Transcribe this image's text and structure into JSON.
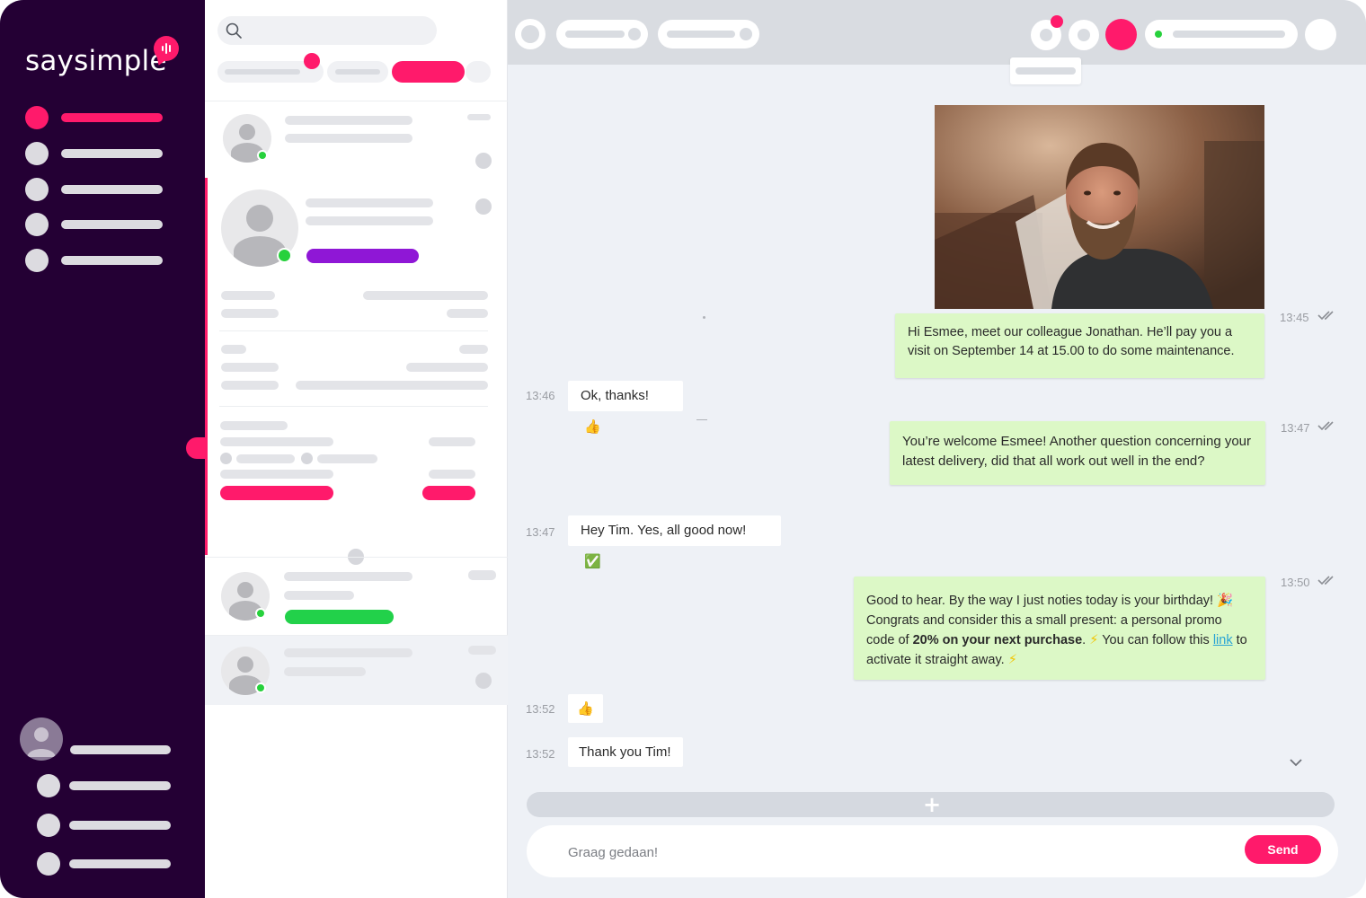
{
  "app": {
    "logo_text": "saysimple",
    "brand_color": "#ff1a6b",
    "sidebar_color": "#240034",
    "online_color": "#27d13c"
  },
  "icons": {
    "logo_badge": "audio-bars-icon",
    "search": "search-icon",
    "scroll_down": "chevron-down-icon",
    "attach": "plus-icon"
  },
  "messages": [
    {
      "direction": "out",
      "time": "13:45",
      "has_image": true,
      "status": "read",
      "text": "Hi Esmee, meet our colleague Jonathan. He’ll pay you a visit on September 14 at 15.00 to do some maintenance."
    },
    {
      "direction": "in",
      "time": "13:46",
      "text": "Ok, thanks!",
      "emoji": "👍"
    },
    {
      "direction": "out",
      "time": "13:47",
      "status": "read",
      "text": "You’re welcome Esmee! Another question concerning your latest delivery, did that all work out well in the end?"
    },
    {
      "direction": "in",
      "time": "13:47",
      "text": "Hey Tim. Yes, all good now!",
      "emoji": "✅"
    },
    {
      "direction": "out",
      "time": "13:50",
      "status": "read",
      "part1": "Good to hear. By the way I just noties today is your birthday!",
      "emoji1": "🎉",
      "part2": "Congrats and consider this a small present: a personal promo code of",
      "bold": "20% on your next purchase",
      "part3": ".",
      "emoji2": "⚡",
      "part4": "You can follow this",
      "link": "link",
      "part5": "to activate it straight away.",
      "emoji3": "⚡"
    },
    {
      "direction": "in",
      "time": "13:52",
      "emoji": "👍"
    },
    {
      "direction": "in",
      "time": "13:52",
      "text": "Thank you Tim!"
    }
  ],
  "composer": {
    "value": "Graag gedaan!",
    "send_label": "Send"
  }
}
